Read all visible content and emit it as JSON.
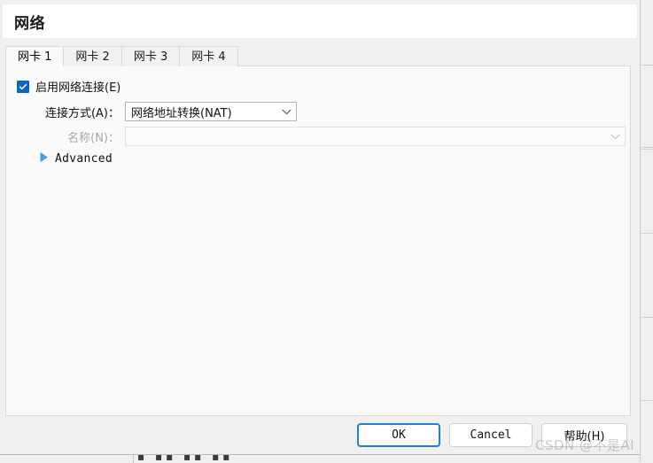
{
  "window": {
    "title": "网络"
  },
  "tabs": [
    {
      "label": "网卡 1",
      "active": true
    },
    {
      "label": "网卡 2",
      "active": false
    },
    {
      "label": "网卡 3",
      "active": false
    },
    {
      "label": "网卡 4",
      "active": false
    }
  ],
  "form": {
    "enable_checkbox": {
      "label": "启用网络连接(E)",
      "checked": true
    },
    "connection_type": {
      "label": "连接方式(A)：",
      "value": "网络地址转换(NAT)",
      "arrow_icon": "chevron-down-icon"
    },
    "name": {
      "label": "名称(N)：",
      "value": "",
      "placeholder": "",
      "disabled": true,
      "arrow_icon": "chevron-down-icon"
    },
    "advanced": {
      "label": "Advanced",
      "expanded": false,
      "arrow_icon": "triangle-right-icon"
    }
  },
  "buttons": {
    "ok": "OK",
    "cancel": "Cancel",
    "help": "帮助(H)"
  },
  "watermark": {
    "text": "CSDN @不是AI"
  },
  "colors": {
    "accent": "#0a64c8",
    "focus_border": "#1e7fd4",
    "panel_bg": "#fafafa",
    "dialog_bg": "#f0f0f0",
    "disabled_text": "#a6a6a6"
  }
}
